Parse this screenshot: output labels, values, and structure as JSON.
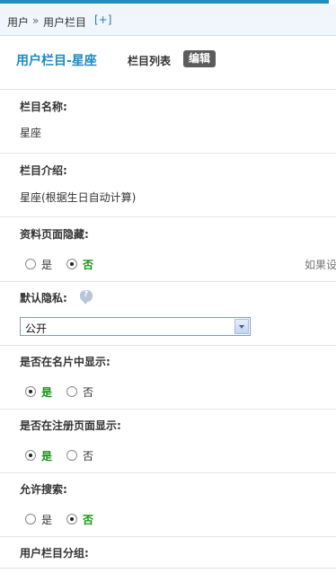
{
  "breadcrumb": {
    "root": "用户",
    "separator": "»",
    "current": "用户栏目",
    "add_label": "[+]"
  },
  "header": {
    "title": "用户栏目-星座",
    "tab_list": "栏目列表",
    "tab_edit": "编辑"
  },
  "fields": {
    "name": {
      "label": "栏目名称:",
      "value": "星座"
    },
    "intro": {
      "label": "栏目介绍:",
      "value": "星座(根据生日自动计算)"
    },
    "hide_in_profile": {
      "label": "资料页面隐藏:",
      "options": [
        "是",
        "否"
      ],
      "selected": "否",
      "hint": "如果设"
    },
    "default_privacy": {
      "label": "默认隐私:",
      "help_icon": "question-bubble-icon",
      "selected_value": "公开"
    },
    "show_in_card": {
      "label": "是否在名片中显示:",
      "options": [
        "是",
        "否"
      ],
      "selected": "是"
    },
    "show_in_register": {
      "label": "是否在注册页面显示:",
      "options": [
        "是",
        "否"
      ],
      "selected": "是"
    },
    "allow_search": {
      "label": "允许搜索:",
      "options": [
        "是",
        "否"
      ],
      "selected": "否"
    },
    "group": {
      "label": "用户栏目分组:"
    }
  },
  "colors": {
    "accent": "#1f8fbf",
    "title": "#1a8cc0",
    "selected_option": "#159415",
    "edit_tab_bg": "#5c5c5c"
  }
}
